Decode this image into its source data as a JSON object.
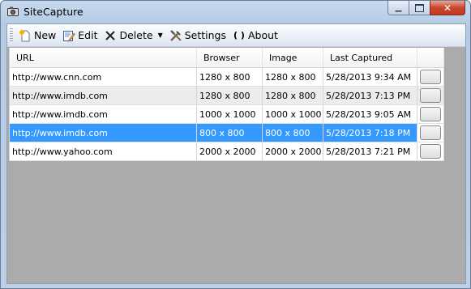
{
  "window": {
    "title": "SiteCapture"
  },
  "toolbar": {
    "new_label": "New",
    "edit_label": "Edit",
    "delete_label": "Delete",
    "settings_label": "Settings",
    "about_label": "About"
  },
  "grid": {
    "columns": [
      "URL",
      "Browser",
      "Image",
      "Last Captured"
    ],
    "rows": [
      {
        "url": "http://www.cnn.com",
        "browser": "1280 x 800",
        "image": "1280 x 800",
        "captured": "5/28/2013 9:34 AM"
      },
      {
        "url": "http://www.imdb.com",
        "browser": "1280 x 800",
        "image": "1280 x 800",
        "captured": "5/28/2013 7:13 PM"
      },
      {
        "url": "http://www.imdb.com",
        "browser": "1000 x 1000",
        "image": "1000 x 1000",
        "captured": "5/28/2013 9:05 AM"
      },
      {
        "url": "http://www.imdb.com",
        "browser": "800 x 800",
        "image": "800 x 800",
        "captured": "5/28/2013 7:18 PM"
      },
      {
        "url": "http://www.yahoo.com",
        "browser": "2000 x 2000",
        "image": "2000 x 2000",
        "captured": "5/28/2013 7:21 PM"
      }
    ],
    "selected_row": 3
  },
  "colors": {
    "selection": "#3399ff",
    "client_bg": "#ababab",
    "close_button": "#c9452c"
  }
}
